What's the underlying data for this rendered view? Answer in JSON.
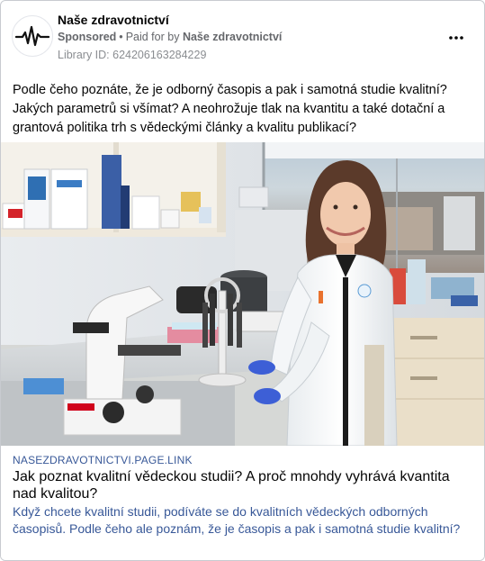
{
  "post": {
    "page_name": "Naše zdravotnictví",
    "sponsored_label": "Sponsored",
    "separator": "•",
    "paid_for_label": "Paid for by",
    "paid_for_page": "Naše zdravotnictví",
    "library_id": "Library ID: 624206163284229",
    "more_icon": "more-options-icon",
    "avatar_icon": "heartbeat-line-icon",
    "text": "Podle čeho poznáte, že je odborný časopis a pak i samotná studie kvalitní? Jakých parametrů si všímat? A neohrožuje tlak na kvantitu a také dotační a grantová politika trh s vědeckými články a kvalitu publikací?"
  },
  "image": {
    "description_icon": "laboratory-photo"
  },
  "link": {
    "domain": "NASEZDRAVOTNICTVI.PAGE.LINK",
    "title": "Jak poznat kvalitní vědeckou studii? A proč mnohdy vyhrává kvantita nad kvalitou?",
    "description": "Když chcete kvalitní studii, podíváte se do kvalitních vědeckých odborných časopisů. Podle čeho ale poznám, že je časopis a pak i samotná studie kvalitní?"
  },
  "colors": {
    "link_blue": "#385898",
    "meta_gray": "#65676b",
    "border": "#c8cbd0"
  }
}
